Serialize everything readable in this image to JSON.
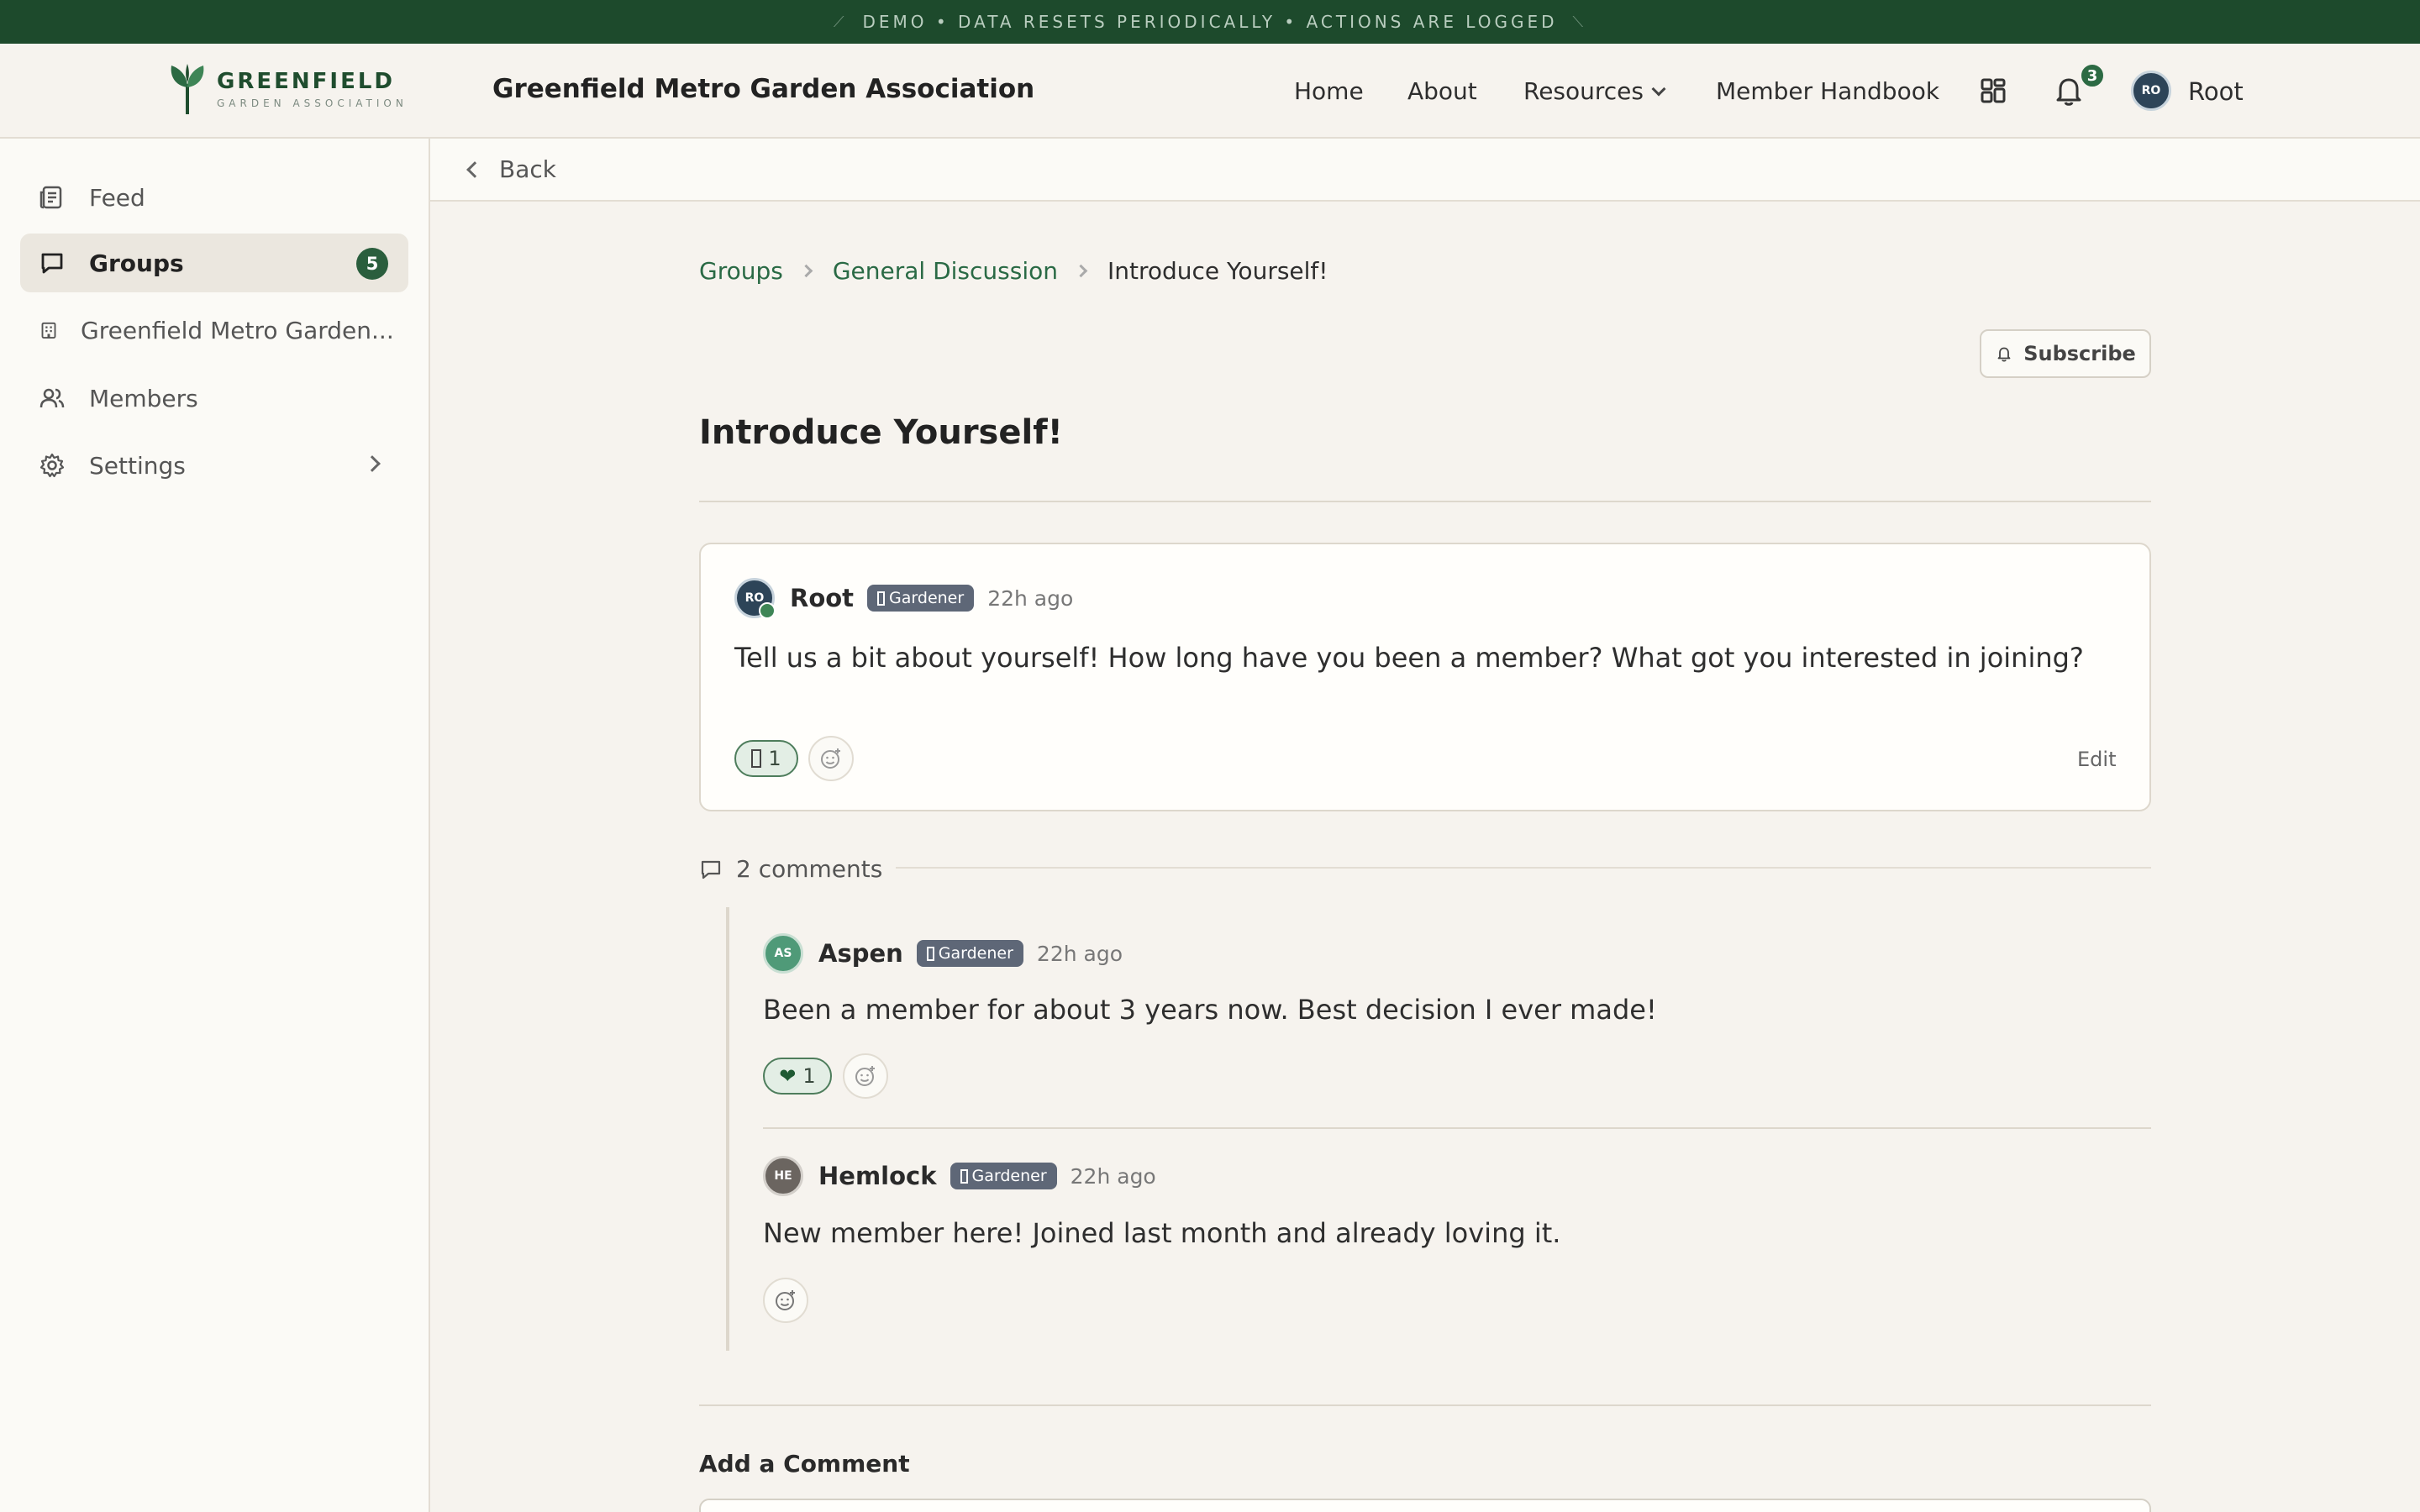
{
  "demo_banner": {
    "text": "DEMO • DATA RESETS PERIODICALLY • ACTIONS ARE LOGGED"
  },
  "header": {
    "logo_title": "GREENFIELD",
    "logo_subtitle": "GARDEN ASSOCIATION",
    "org_title": "Greenfield Metro Garden Association",
    "nav": {
      "home": "Home",
      "about": "About",
      "resources": "Resources",
      "handbook": "Member Handbook"
    },
    "notification_count": "3",
    "user_initials": "RO",
    "user_name": "Root",
    "colors": {
      "brand": "#1d4a2c",
      "accent": "#2c6a43"
    }
  },
  "sidebar": {
    "items": [
      {
        "label": "Feed",
        "icon": "newspaper-icon"
      },
      {
        "label": "Groups",
        "icon": "chat-bubble-icon",
        "badge": "5",
        "active": true
      },
      {
        "label": "Greenfield Metro Garden...",
        "icon": "building-icon"
      },
      {
        "label": "Members",
        "icon": "users-icon"
      },
      {
        "label": "Settings",
        "icon": "gear-icon"
      }
    ]
  },
  "backbar": {
    "label": "Back"
  },
  "breadcrumb": {
    "items": [
      "Groups",
      "General Discussion",
      "Introduce Yourself!"
    ]
  },
  "subscribe_label": "Subscribe",
  "page_title": "Introduce Yourself!",
  "post": {
    "author": "Root",
    "initials": "RO",
    "role": "Gardener",
    "time": "22h ago",
    "text": "Tell us a bit about yourself! How long have you been a member? What got you interested in joining?",
    "reaction_count": "1",
    "edit_label": "Edit"
  },
  "comments": {
    "count_label": "2 comments",
    "items": [
      {
        "author": "Aspen",
        "initials": "AS",
        "role": "Gardener",
        "time": "22h ago",
        "text": "Been a member for about 3 years now. Best decision I ever made!",
        "reaction_count": "1",
        "avatar_color": "#4f9a78"
      },
      {
        "author": "Hemlock",
        "initials": "HE",
        "role": "Gardener",
        "time": "22h ago",
        "text": "New member here! Joined last month and already loving it.",
        "avatar_color": "#6b6560"
      }
    ]
  },
  "add_comment_title": "Add a Comment"
}
